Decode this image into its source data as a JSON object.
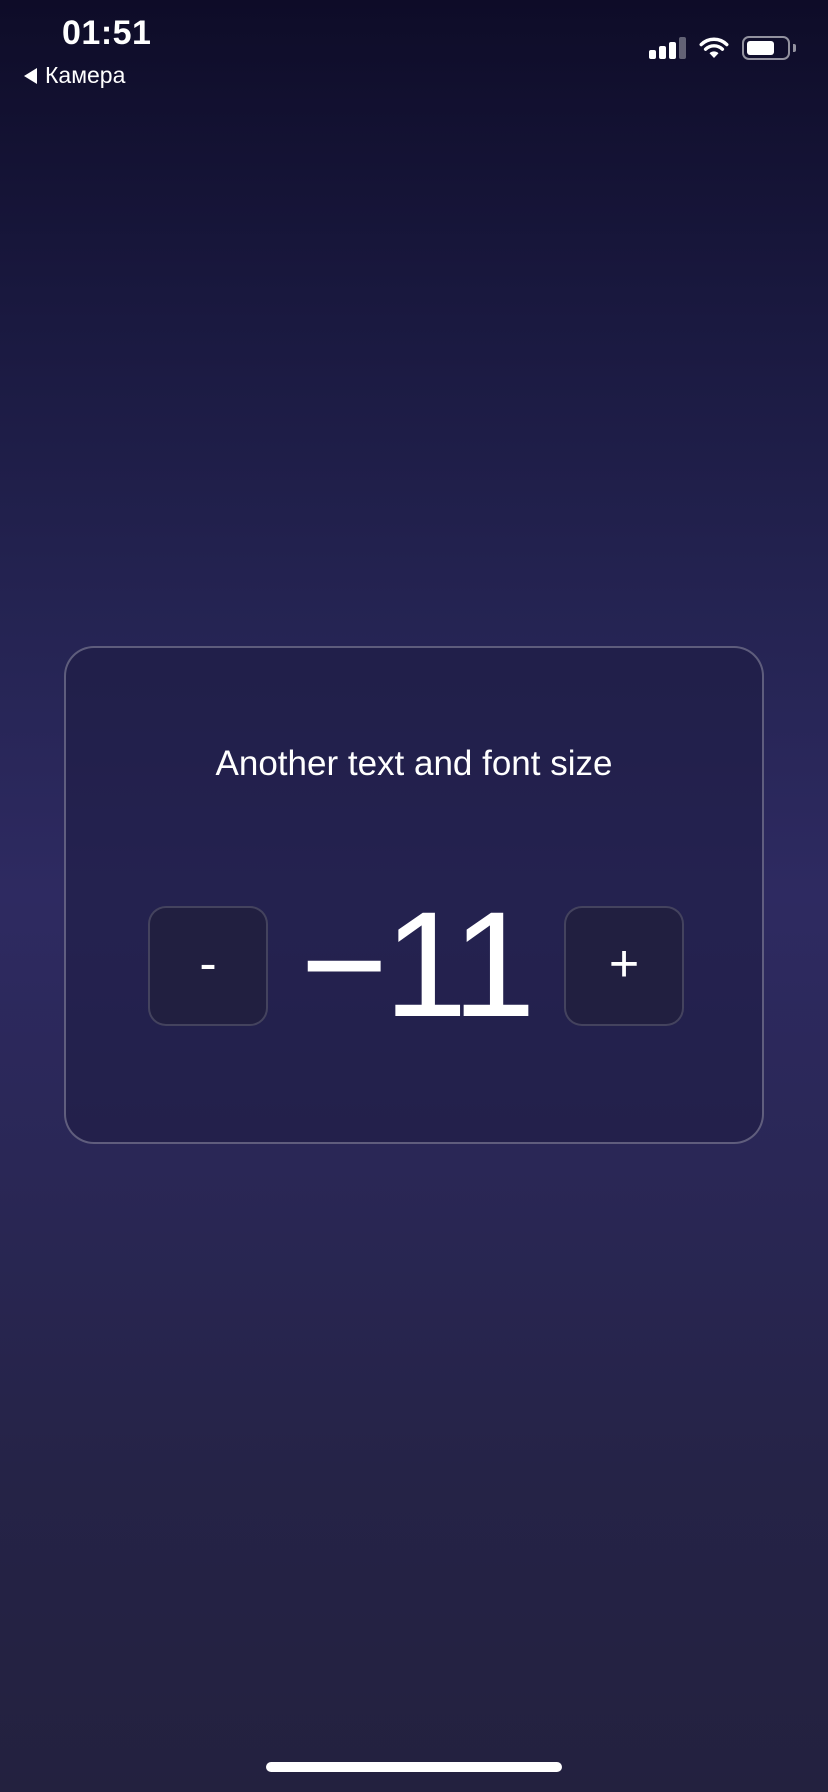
{
  "status_bar": {
    "time": "01:51",
    "back_label": "Камера",
    "battery_level_percent": 70,
    "signal_bars_active": 3,
    "signal_bars_total": 4
  },
  "card": {
    "title": "Another text and font size",
    "decrement_label": "-",
    "increment_label": "+",
    "value": "−11"
  },
  "colors": {
    "background_top": "#0e0c28",
    "background_mid": "#2e2a61",
    "background_bottom": "#23213f",
    "card_border": "#5a5878",
    "button_bg": "#211f40",
    "text": "#ffffff"
  },
  "icons": {
    "back": "back-arrow-icon",
    "signal": "signal-icon",
    "wifi": "wifi-icon",
    "battery": "battery-icon"
  }
}
